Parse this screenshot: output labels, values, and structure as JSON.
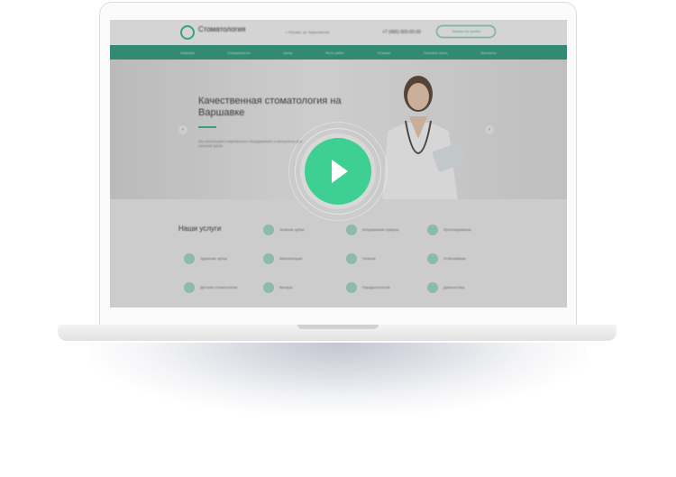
{
  "site": {
    "logo_text": "Стоматология",
    "logo_sub": "",
    "address": "г. Москва, ул. Варшавская",
    "phone": "+7 (495) 000-00-00",
    "cta_label": "Запись на приём"
  },
  "nav": [
    "Клиника",
    "Специалисты",
    "Цены",
    "Фото работ",
    "Отзывы",
    "Полезно знать",
    "Контакты"
  ],
  "hero": {
    "title": "Качественная стоматология на Варшавке",
    "text": "Мы используем современное оборудование и материалы для лечения зубов"
  },
  "services": {
    "title": "Наши услуги",
    "items": [
      "Лечение зубов",
      "Исправление прикуса",
      "Протезирование",
      "Удаление зубов",
      "Имплантация",
      "Гигиена",
      "Отбеливание",
      "Детская стоматология",
      "Виниры",
      "Пародонтология",
      "Диагностика"
    ]
  },
  "colors": {
    "accent": "#3ecf93",
    "nav": "#2f9b7d"
  },
  "icons": {
    "play": "play-icon",
    "prev": "chevron-left-icon",
    "next": "chevron-right-icon"
  }
}
